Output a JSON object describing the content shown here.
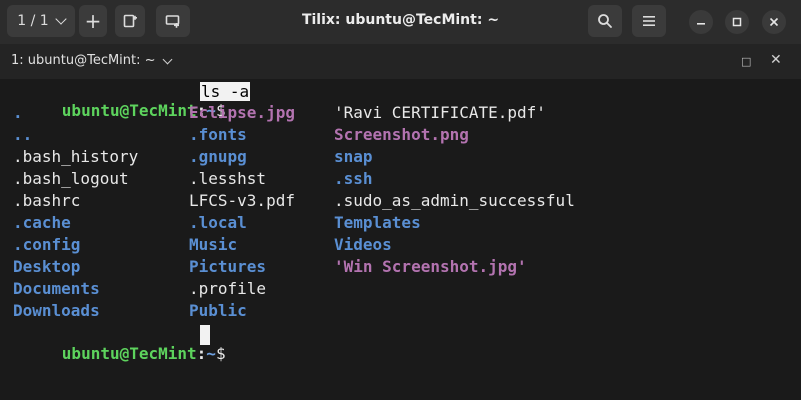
{
  "window": {
    "title": "Tilix: ubuntu@TecMint: ~",
    "session_indicator": "1 / 1",
    "add_label": "+",
    "icons": {
      "chevron": "chevron-down-icon",
      "add": "plus-icon",
      "split_right": "split-right-icon",
      "split_down": "split-down-icon",
      "search": "search-icon",
      "menu": "hamburger-menu-icon",
      "minimize": "minimize-icon",
      "maximize": "maximize-icon",
      "close": "close-icon"
    }
  },
  "tab": {
    "label": "1: ubuntu@TecMint: ~",
    "maximize_glyph": "□",
    "close_glyph": "✕"
  },
  "terminal": {
    "prompt_user": "ubuntu@TecMint",
    "prompt_colon": ":",
    "prompt_path": "~",
    "prompt_dollar": "$",
    "command": "ls -a",
    "columns": [
      [
        {
          "name": ".",
          "type": "dir"
        },
        {
          "name": "..",
          "type": "dir"
        },
        {
          "name": ".bash_history",
          "type": "file"
        },
        {
          "name": ".bash_logout",
          "type": "file"
        },
        {
          "name": ".bashrc",
          "type": "file"
        },
        {
          "name": ".cache",
          "type": "dir"
        },
        {
          "name": ".config",
          "type": "dir"
        },
        {
          "name": "Desktop",
          "type": "dir"
        },
        {
          "name": "Documents",
          "type": "dir"
        },
        {
          "name": "Downloads",
          "type": "dir"
        }
      ],
      [
        {
          "name": "Eclipse.jpg",
          "type": "img"
        },
        {
          "name": ".fonts",
          "type": "dir"
        },
        {
          "name": ".gnupg",
          "type": "dir"
        },
        {
          "name": ".lesshst",
          "type": "file"
        },
        {
          "name": "LFCS-v3.pdf",
          "type": "file"
        },
        {
          "name": ".local",
          "type": "dir"
        },
        {
          "name": "Music",
          "type": "dir"
        },
        {
          "name": "Pictures",
          "type": "dir"
        },
        {
          "name": ".profile",
          "type": "file"
        },
        {
          "name": "Public",
          "type": "dir"
        }
      ],
      [
        {
          "name": "'Ravi CERTIFICATE.pdf'",
          "type": "file"
        },
        {
          "name": "Screenshot.png",
          "type": "img"
        },
        {
          "name": "snap",
          "type": "dir"
        },
        {
          "name": ".ssh",
          "type": "dir"
        },
        {
          "name": ".sudo_as_admin_successful",
          "type": "file"
        },
        {
          "name": "Templates",
          "type": "dir"
        },
        {
          "name": "Videos",
          "type": "dir"
        },
        {
          "name": "'Win Screenshot.jpg'",
          "type": "img"
        }
      ]
    ],
    "colors": {
      "background": "#1a1a1a",
      "directory": "#5a8fd3",
      "image": "#b373b0",
      "file": "#e8e8e8",
      "user": "#5dd35d",
      "path": "#6ea0e0"
    }
  }
}
